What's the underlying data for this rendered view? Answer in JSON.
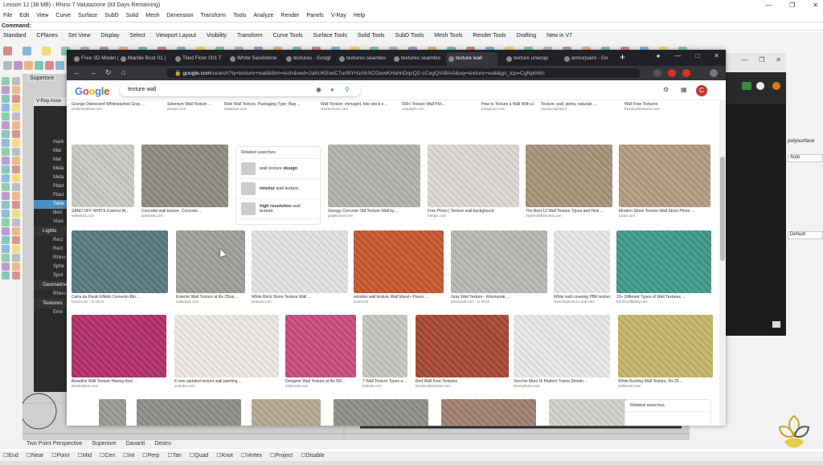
{
  "rhino": {
    "title": "Lesson 12 (38 MB) - Rhino 7 Valutazione (83 Days Remaining)",
    "menu": [
      "File",
      "Edit",
      "View",
      "Curve",
      "Surface",
      "SubD",
      "Solid",
      "Mesh",
      "Dimension",
      "Transform",
      "Tools",
      "Analyze",
      "Render",
      "Panels",
      "V-Ray",
      "Help"
    ],
    "command_label": "Command:",
    "toolbar_tabs": [
      "Standard",
      "CPlanes",
      "Set View",
      "Display",
      "Select",
      "Viewport Layout",
      "Visibility",
      "Transform",
      "Curve Tools",
      "Surface Tools",
      "Solid Tools",
      "SubD Tools",
      "Mesh Tools",
      "Render Tools",
      "Drafting",
      "New in V7"
    ],
    "viewport_label": "Superiore",
    "vray_title": "V-Ray Asse",
    "vray_items": [
      "mark",
      "Mat",
      "Mat",
      "Meta",
      "Meta",
      "Plast",
      "Plast",
      "Table",
      "tiled",
      "Visio"
    ],
    "vray_selected_index": 7,
    "vray_sections": [
      {
        "title": "Lights",
        "items": [
          "Rect",
          "Rect",
          "Rhino",
          "Sphe",
          "Spot"
        ]
      },
      {
        "title": "Geometries",
        "items": [
          "Rhino"
        ]
      },
      {
        "title": "Textures",
        "items": [
          "Envi"
        ]
      }
    ],
    "right_panel": {
      "polysurface": "polysurface",
      "auto": "Auto",
      "default": "Default"
    },
    "view_tabs": [
      "Two Point Perspective",
      "Superiore",
      "Davanti",
      "Destro"
    ],
    "osnaps": [
      "End",
      "Near",
      "Point",
      "Mid",
      "Cen",
      "Int",
      "Perp",
      "Tan",
      "Quad",
      "Knot",
      "Vertex",
      "Project",
      "Disable"
    ]
  },
  "browser": {
    "tabs": [
      {
        "label": "Free 3D Model (",
        "active": false
      },
      {
        "label": "Marble Bust 01 |",
        "active": false
      },
      {
        "label": "Tiled Floor 001 T",
        "active": false
      },
      {
        "label": "White Sandstone",
        "active": false
      },
      {
        "label": "textures - Googl",
        "active": false
      },
      {
        "label": "textures seamles",
        "active": false
      },
      {
        "label": "textures seamles",
        "active": false
      },
      {
        "label": "texture wall",
        "active": true
      },
      {
        "label": "texture unwrap",
        "active": false
      },
      {
        "label": "armorpaint - Go",
        "active": false
      }
    ],
    "url_host": "google.com",
    "url_rest": "/search?q=texture+wall&tbm=isch&ved=2ahUKEwiC7ur9tYHzAhXCGewKHahnDqcQ2-cCegQIABAA&oq=texture+wall&gs_lcp=CgNpbWc",
    "google_logo": "Google",
    "query": "texture wall",
    "avatar_letter": "C"
  },
  "results": {
    "row0": [
      {
        "cap": "Grunge Distressed Whitewashed Gray ...",
        "src": "wallsneedlove.com",
        "color": "#9a9a94"
      },
      {
        "cap": "Selenium Wall Texture ...",
        "src": "photos.com",
        "color": "#5d8f8a"
      },
      {
        "cap": "Rohi Wall Texture, Packaging Type: Bag ...",
        "src": "indiamart.com",
        "color": "#7c8a80"
      },
      {
        "cap": "Wall Texture: immagini, foto stock e ...",
        "src": "shutterstock.com",
        "color": "#e8e8e8"
      },
      {
        "cap": "500+ Texture Wall Pict...",
        "src": "unsplash.com",
        "color": "#eaeaea"
      },
      {
        "cap": "How to Texture a Wall With a Roller",
        "src": "thespruce.com",
        "color": "#d8d6d2"
      },
      {
        "cap": "Texture, wall, pietra, naturale ...",
        "src": "canstockphoto.it",
        "color": "#8f8a7c"
      },
      {
        "cap": "Wall Free Textures",
        "src": "freestocktextures.com",
        "color": "#9a4b3c"
      }
    ],
    "row1": [
      {
        "cap": "SAND OFF WHITE Exterior W...",
        "src": "indiamart.com",
        "color": "#c9c9c4"
      },
      {
        "cap": "Concrete wall texture, Concrete ...",
        "src": "pinterest.com",
        "color": "#8e8b80"
      },
      {
        "cap": "Grungy Concrete Old Texture Wall by ...",
        "src": "graphicriver.net",
        "color": "#b4b2ad"
      },
      {
        "cap": "Free Photo | Texture wall background",
        "src": "freepik.com",
        "color": "#dcd7d3"
      },
      {
        "cap": "The Best 13 Wall Texture Types and How ...",
        "src": "rhythmofthehome.com",
        "color": "#a6937a"
      },
      {
        "cap": "Modern Stone Texture Wall Stock Photo ...",
        "src": "123rf.com",
        "color": "#b49a82"
      }
    ],
    "related_title": "Related searches",
    "related_items": [
      {
        "pre": "wall texture ",
        "bold": "design",
        "post": ""
      },
      {
        "pre": "",
        "bold": "interior",
        "post": " wall texture"
      },
      {
        "pre": "",
        "bold": "high resolution",
        "post": " wall texture"
      }
    ],
    "row2": [
      {
        "cap": "Carta da Parati Effetto Cemento Blu ...",
        "src": "hovia.com · In stock",
        "color": "#557a80"
      },
      {
        "cap": "Exterior Wall Texture at Rs 25/sq ...",
        "src": "indiamart.com",
        "color": "#9c9e98"
      },
      {
        "cap": "White Brick Stone Texture Wall ...",
        "src": "azutura.com",
        "color": "#e2e2e2"
      },
      {
        "cap": "wooden wall texture Wall Mural • Pixers ...",
        "src": "pixers.hk",
        "color": "#c8582c"
      },
      {
        "cap": "Gray Wall Texture - fotomurale ...",
        "src": "photowall.com · In stock",
        "color": "#b8b8b5"
      },
      {
        "cap": "White wall covering PBR texture ...",
        "src": "sketchuptexture club.com",
        "color": "#e6e6e6"
      },
      {
        "cap": "15+ Different Types of Wall Textures ...",
        "src": "farmfoodfamily.com",
        "color": "#3f9a8a"
      }
    ],
    "row3": [
      {
        "cap": "Beautiful Wall Texture Having Red ...",
        "src": "dreamstime.com",
        "color": "#b2306a"
      },
      {
        "cap": "8 new updated texture wall painting ...",
        "src": "youtube.com",
        "color": "#ece9e4"
      },
      {
        "cap": "Designer Wall Texture at Rs 50/...",
        "src": "indiamart.com",
        "color": "#c94c7c"
      },
      {
        "cap": "7 Wall Texture Types a...",
        "src": "bobvila.com",
        "color": "#c5c5c0"
      },
      {
        "cap": "Red Wall Free Textures",
        "src": "freestocktextures.com",
        "color": "#a54a35"
      },
      {
        "cap": "Vecchio Muro Di Mattoni Trama Sfondo ...",
        "src": "istockphoto.com",
        "color": "#e8e8e6"
      },
      {
        "cap": "White Rusting Wall Texture, Rs 25 ...",
        "src": "indiamart.com",
        "color": "#c6b468"
      }
    ],
    "row4": [
      {
        "color": "#9a9a94"
      },
      {
        "color": "#8e8e8a"
      },
      {
        "color": "#b5aa90"
      },
      {
        "color": "#8f8f8c"
      },
      {
        "color": "#a08070"
      },
      {
        "color": "#d0cfca"
      }
    ],
    "related_bottom_title": "Related searches"
  }
}
